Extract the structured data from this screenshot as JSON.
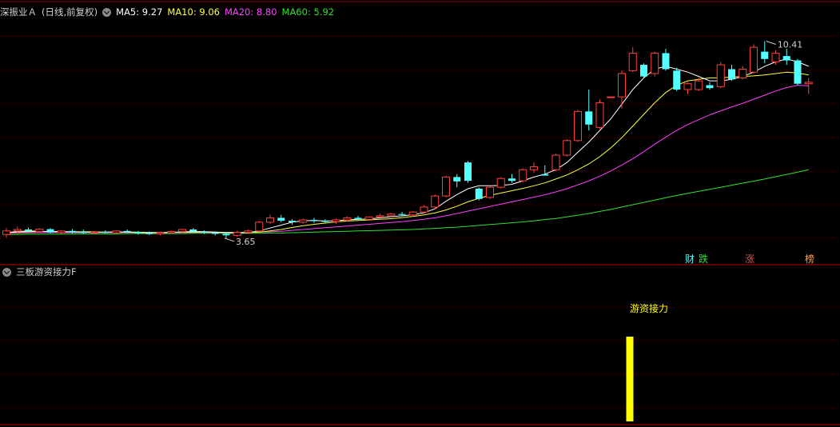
{
  "main_header": {
    "stock_name": "深振业Ａ",
    "period": "(日线,前复权)",
    "ma5": "MA5: 9.27",
    "ma10": "MA10: 9.06",
    "ma20": "MA20: 8.80",
    "ma60": "MA60: 5.92"
  },
  "sub_header": {
    "title": "三板游资接力F"
  },
  "colors": {
    "background": "#000000",
    "grid": "#7a0000",
    "up": "#ff4040",
    "down": "#54ffff",
    "ma5": "#ffffff",
    "ma10": "#ffff40",
    "ma20": "#ff40ff",
    "ma60": "#30e030",
    "indicator_bar": "#ffff00",
    "title_text": "#c8c8c8"
  },
  "chart_data": [
    {
      "type": "candlestick",
      "title": "深振业Ａ (日线,前复权)",
      "y_range": [
        3.1,
        11.0
      ],
      "max_label": "10.41",
      "min_label": "3.65",
      "candles": [
        {
          "o": 3.78,
          "h": 4.0,
          "l": 3.68,
          "c": 3.9
        },
        {
          "o": 3.9,
          "h": 4.05,
          "l": 3.8,
          "c": 3.95
        },
        {
          "o": 3.95,
          "h": 4.02,
          "l": 3.85,
          "c": 3.88
        },
        {
          "o": 3.88,
          "h": 4.0,
          "l": 3.84,
          "c": 3.96
        },
        {
          "o": 3.96,
          "h": 4.0,
          "l": 3.82,
          "c": 3.85
        },
        {
          "o": 3.85,
          "h": 3.93,
          "l": 3.8,
          "c": 3.9
        },
        {
          "o": 3.9,
          "h": 3.96,
          "l": 3.82,
          "c": 3.86
        },
        {
          "o": 3.86,
          "h": 3.95,
          "l": 3.8,
          "c": 3.84
        },
        {
          "o": 3.84,
          "h": 3.9,
          "l": 3.78,
          "c": 3.86
        },
        {
          "o": 3.86,
          "h": 3.92,
          "l": 3.82,
          "c": 3.84
        },
        {
          "o": 3.84,
          "h": 3.92,
          "l": 3.8,
          "c": 3.9
        },
        {
          "o": 3.9,
          "h": 3.95,
          "l": 3.83,
          "c": 3.86
        },
        {
          "o": 3.86,
          "h": 3.9,
          "l": 3.78,
          "c": 3.82
        },
        {
          "o": 3.82,
          "h": 3.88,
          "l": 3.76,
          "c": 3.8
        },
        {
          "o": 3.8,
          "h": 3.88,
          "l": 3.75,
          "c": 3.84
        },
        {
          "o": 3.84,
          "h": 3.92,
          "l": 3.8,
          "c": 3.88
        },
        {
          "o": 3.88,
          "h": 3.98,
          "l": 3.84,
          "c": 3.95
        },
        {
          "o": 3.95,
          "h": 4.0,
          "l": 3.85,
          "c": 3.88
        },
        {
          "o": 3.88,
          "h": 3.92,
          "l": 3.8,
          "c": 3.84
        },
        {
          "o": 3.84,
          "h": 3.88,
          "l": 3.75,
          "c": 3.8
        },
        {
          "o": 3.8,
          "h": 3.82,
          "l": 3.65,
          "c": 3.75
        },
        {
          "o": 3.75,
          "h": 3.9,
          "l": 3.7,
          "c": 3.85
        },
        {
          "o": 3.85,
          "h": 3.95,
          "l": 3.8,
          "c": 3.9
        },
        {
          "o": 3.9,
          "h": 4.25,
          "l": 3.88,
          "c": 4.2
        },
        {
          "o": 4.2,
          "h": 4.45,
          "l": 4.15,
          "c": 4.35
        },
        {
          "o": 4.35,
          "h": 4.45,
          "l": 4.2,
          "c": 4.25
        },
        {
          "o": 4.25,
          "h": 4.3,
          "l": 4.12,
          "c": 4.2
        },
        {
          "o": 4.2,
          "h": 4.32,
          "l": 4.15,
          "c": 4.28
        },
        {
          "o": 4.28,
          "h": 4.35,
          "l": 4.18,
          "c": 4.24
        },
        {
          "o": 4.24,
          "h": 4.3,
          "l": 4.18,
          "c": 4.22
        },
        {
          "o": 4.22,
          "h": 4.32,
          "l": 4.15,
          "c": 4.28
        },
        {
          "o": 4.28,
          "h": 4.4,
          "l": 4.22,
          "c": 4.35
        },
        {
          "o": 4.35,
          "h": 4.42,
          "l": 4.28,
          "c": 4.3
        },
        {
          "o": 4.3,
          "h": 4.4,
          "l": 4.25,
          "c": 4.38
        },
        {
          "o": 4.38,
          "h": 4.48,
          "l": 4.3,
          "c": 4.42
        },
        {
          "o": 4.42,
          "h": 4.52,
          "l": 4.36,
          "c": 4.48
        },
        {
          "o": 4.48,
          "h": 4.55,
          "l": 4.4,
          "c": 4.45
        },
        {
          "o": 4.45,
          "h": 4.58,
          "l": 4.4,
          "c": 4.55
        },
        {
          "o": 4.55,
          "h": 4.78,
          "l": 4.5,
          "c": 4.72
        },
        {
          "o": 4.72,
          "h": 5.15,
          "l": 4.65,
          "c": 5.1
        },
        {
          "o": 5.1,
          "h": 5.8,
          "l": 5.05,
          "c": 5.75
        },
        {
          "o": 5.75,
          "h": 5.85,
          "l": 5.4,
          "c": 5.6
        },
        {
          "o": 6.25,
          "h": 6.3,
          "l": 5.55,
          "c": 5.62
        },
        {
          "o": 5.35,
          "h": 5.4,
          "l": 4.95,
          "c": 5.0
        },
        {
          "o": 5.05,
          "h": 5.45,
          "l": 5.0,
          "c": 5.4
        },
        {
          "o": 5.4,
          "h": 5.75,
          "l": 5.35,
          "c": 5.7
        },
        {
          "o": 5.7,
          "h": 5.85,
          "l": 5.55,
          "c": 5.62
        },
        {
          "o": 5.62,
          "h": 6.05,
          "l": 5.58,
          "c": 6.0
        },
        {
          "o": 6.0,
          "h": 6.25,
          "l": 5.9,
          "c": 6.1
        },
        {
          "o": 5.85,
          "h": 6.15,
          "l": 5.8,
          "c": 5.8
        },
        {
          "o": 6.0,
          "h": 6.55,
          "l": 5.95,
          "c": 6.5
        },
        {
          "o": 6.5,
          "h": 7.05,
          "l": 6.45,
          "c": 7.0
        },
        {
          "o": 7.0,
          "h": 8.05,
          "l": 6.95,
          "c": 8.0
        },
        {
          "o": 8.0,
          "h": 8.75,
          "l": 7.35,
          "c": 7.55
        },
        {
          "o": 7.45,
          "h": 8.4,
          "l": 7.4,
          "c": 8.3
        },
        {
          "o": 8.5,
          "h": 8.5,
          "l": 8.5,
          "c": 8.5
        },
        {
          "o": 8.5,
          "h": 9.4,
          "l": 8.1,
          "c": 9.3
        },
        {
          "o": 9.4,
          "h": 10.2,
          "l": 9.35,
          "c": 10.0
        },
        {
          "o": 9.6,
          "h": 9.65,
          "l": 9.15,
          "c": 9.2
        },
        {
          "o": 9.3,
          "h": 10.05,
          "l": 9.2,
          "c": 10.0
        },
        {
          "o": 10.0,
          "h": 10.15,
          "l": 9.4,
          "c": 9.45
        },
        {
          "o": 9.4,
          "h": 9.5,
          "l": 8.7,
          "c": 8.75
        },
        {
          "o": 8.75,
          "h": 9.0,
          "l": 8.6,
          "c": 8.95
        },
        {
          "o": 8.75,
          "h": 9.15,
          "l": 8.7,
          "c": 9.05
        },
        {
          "o": 8.9,
          "h": 9.0,
          "l": 8.75,
          "c": 8.8
        },
        {
          "o": 8.85,
          "h": 9.7,
          "l": 8.8,
          "c": 9.6
        },
        {
          "o": 9.45,
          "h": 9.6,
          "l": 9.05,
          "c": 9.1
        },
        {
          "o": 9.15,
          "h": 9.55,
          "l": 9.1,
          "c": 9.45
        },
        {
          "o": 9.35,
          "h": 10.3,
          "l": 9.3,
          "c": 10.2
        },
        {
          "o": 10.05,
          "h": 10.41,
          "l": 9.65,
          "c": 9.8
        },
        {
          "o": 9.7,
          "h": 10.1,
          "l": 9.6,
          "c": 10.0
        },
        {
          "o": 9.9,
          "h": 10.15,
          "l": 9.6,
          "c": 9.75
        },
        {
          "o": 9.75,
          "h": 9.8,
          "l": 8.9,
          "c": 8.95
        },
        {
          "o": 8.95,
          "h": 9.15,
          "l": 8.6,
          "c": 9.0
        }
      ],
      "ma5": [
        3.85,
        3.88,
        3.9,
        3.89,
        3.88,
        3.87,
        3.86,
        3.86,
        3.85,
        3.86,
        3.86,
        3.86,
        3.84,
        3.84,
        3.84,
        3.85,
        3.87,
        3.88,
        3.88,
        3.86,
        3.84,
        3.84,
        3.84,
        3.9,
        4.0,
        4.1,
        4.2,
        4.25,
        4.26,
        4.24,
        4.25,
        4.28,
        4.3,
        4.31,
        4.35,
        4.39,
        4.42,
        4.46,
        4.52,
        4.66,
        4.92,
        5.15,
        5.35,
        5.45,
        5.45,
        5.46,
        5.5,
        5.62,
        5.75,
        5.85,
        6.0,
        6.25,
        6.6,
        6.95,
        7.35,
        7.75,
        8.25,
        8.75,
        9.15,
        9.45,
        9.55,
        9.45,
        9.35,
        9.2,
        9.05,
        9.05,
        9.1,
        9.2,
        9.35,
        9.55,
        9.7,
        9.8,
        9.7,
        9.55
      ],
      "ma10": [
        3.84,
        3.86,
        3.87,
        3.88,
        3.88,
        3.88,
        3.87,
        3.87,
        3.87,
        3.86,
        3.86,
        3.86,
        3.86,
        3.85,
        3.85,
        3.85,
        3.86,
        3.86,
        3.86,
        3.86,
        3.85,
        3.85,
        3.85,
        3.86,
        3.9,
        3.95,
        4.02,
        4.08,
        4.13,
        4.17,
        4.21,
        4.24,
        4.26,
        4.28,
        4.3,
        4.32,
        4.36,
        4.4,
        4.45,
        4.52,
        4.62,
        4.75,
        4.9,
        5.02,
        5.12,
        5.2,
        5.28,
        5.36,
        5.45,
        5.55,
        5.68,
        5.82,
        6.0,
        6.2,
        6.45,
        6.75,
        7.1,
        7.5,
        7.9,
        8.3,
        8.65,
        8.9,
        9.05,
        9.1,
        9.15,
        9.15,
        9.18,
        9.2,
        9.22,
        9.25,
        9.3,
        9.35,
        9.32,
        9.25
      ],
      "ma20": [
        3.82,
        3.83,
        3.84,
        3.85,
        3.85,
        3.85,
        3.85,
        3.85,
        3.85,
        3.85,
        3.85,
        3.85,
        3.85,
        3.85,
        3.85,
        3.85,
        3.85,
        3.85,
        3.85,
        3.85,
        3.85,
        3.85,
        3.85,
        3.86,
        3.87,
        3.89,
        3.92,
        3.95,
        3.98,
        4.01,
        4.04,
        4.07,
        4.1,
        4.13,
        4.16,
        4.19,
        4.22,
        4.26,
        4.3,
        4.35,
        4.42,
        4.5,
        4.58,
        4.66,
        4.74,
        4.82,
        4.9,
        4.98,
        5.06,
        5.14,
        5.24,
        5.35,
        5.48,
        5.62,
        5.78,
        5.96,
        6.16,
        6.38,
        6.62,
        6.88,
        7.12,
        7.35,
        7.55,
        7.72,
        7.88,
        8.02,
        8.15,
        8.28,
        8.42,
        8.56,
        8.7,
        8.82,
        8.9,
        8.88
      ],
      "ma60": [
        3.78,
        3.78,
        3.79,
        3.79,
        3.79,
        3.79,
        3.8,
        3.8,
        3.8,
        3.8,
        3.8,
        3.81,
        3.81,
        3.81,
        3.81,
        3.81,
        3.81,
        3.82,
        3.82,
        3.82,
        3.82,
        3.82,
        3.82,
        3.82,
        3.83,
        3.83,
        3.84,
        3.85,
        3.86,
        3.87,
        3.88,
        3.89,
        3.9,
        3.91,
        3.92,
        3.93,
        3.94,
        3.95,
        3.97,
        3.99,
        4.01,
        4.03,
        4.06,
        4.09,
        4.12,
        4.15,
        4.18,
        4.21,
        4.25,
        4.29,
        4.33,
        4.38,
        4.44,
        4.5,
        4.57,
        4.64,
        4.72,
        4.8,
        4.88,
        4.96,
        5.04,
        5.12,
        5.19,
        5.26,
        5.33,
        5.4,
        5.47,
        5.54,
        5.61,
        5.68,
        5.76,
        5.84,
        5.92,
        6.0
      ],
      "markers": [
        {
          "text": "财",
          "color": "#54ffff"
        },
        {
          "text": "跌",
          "color": "#30e030"
        },
        {
          "text": "涨",
          "color": "#ff4040"
        },
        {
          "text": "榜",
          "color": "#ffa040"
        }
      ]
    },
    {
      "type": "bar",
      "title": "三板游资接力F",
      "series": [
        {
          "name": "游资接力",
          "index": 56,
          "value": 1
        }
      ],
      "label": "游资接力"
    }
  ]
}
